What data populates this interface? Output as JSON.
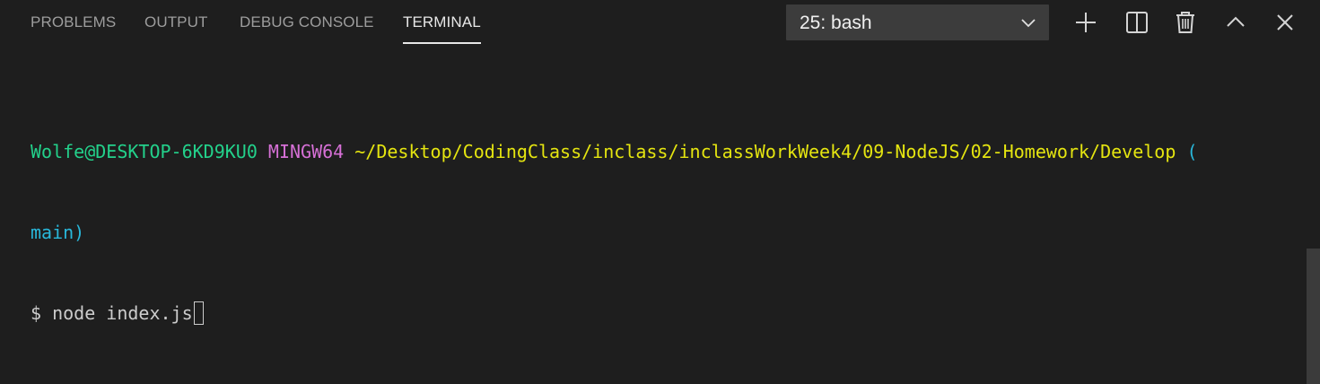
{
  "panel": {
    "tabs": [
      {
        "label": "PROBLEMS",
        "active": false
      },
      {
        "label": "OUTPUT",
        "active": false
      },
      {
        "label": "DEBUG CONSOLE",
        "active": false
      },
      {
        "label": "TERMINAL",
        "active": true
      }
    ],
    "terminal_selector": {
      "selected": "25: bash"
    },
    "actions": [
      {
        "name": "new-terminal",
        "icon": "plus-icon"
      },
      {
        "name": "split-terminal",
        "icon": "split-icon"
      },
      {
        "name": "kill-terminal",
        "icon": "trash-icon"
      },
      {
        "name": "maximize-panel",
        "icon": "chevron-up-icon"
      },
      {
        "name": "close-panel",
        "icon": "close-icon"
      }
    ]
  },
  "terminal": {
    "prompt": {
      "user_host": "Wolfe@DESKTOP-6KD9KU0",
      "env": "MINGW64",
      "path": "~/Desktop/CodingClass/inclass/inclassWorkWeek4/09-NodeJS/02-Homework/Develop",
      "branch_open": "(",
      "branch_close": "main)"
    },
    "command_symbol": "$",
    "command": "node index.js"
  },
  "colors": {
    "background": "#1e1e1e",
    "user_host": "#23d18b",
    "env": "#d670d6",
    "path": "#e5e510",
    "branch": "#29b8db",
    "text": "#cccccc"
  }
}
